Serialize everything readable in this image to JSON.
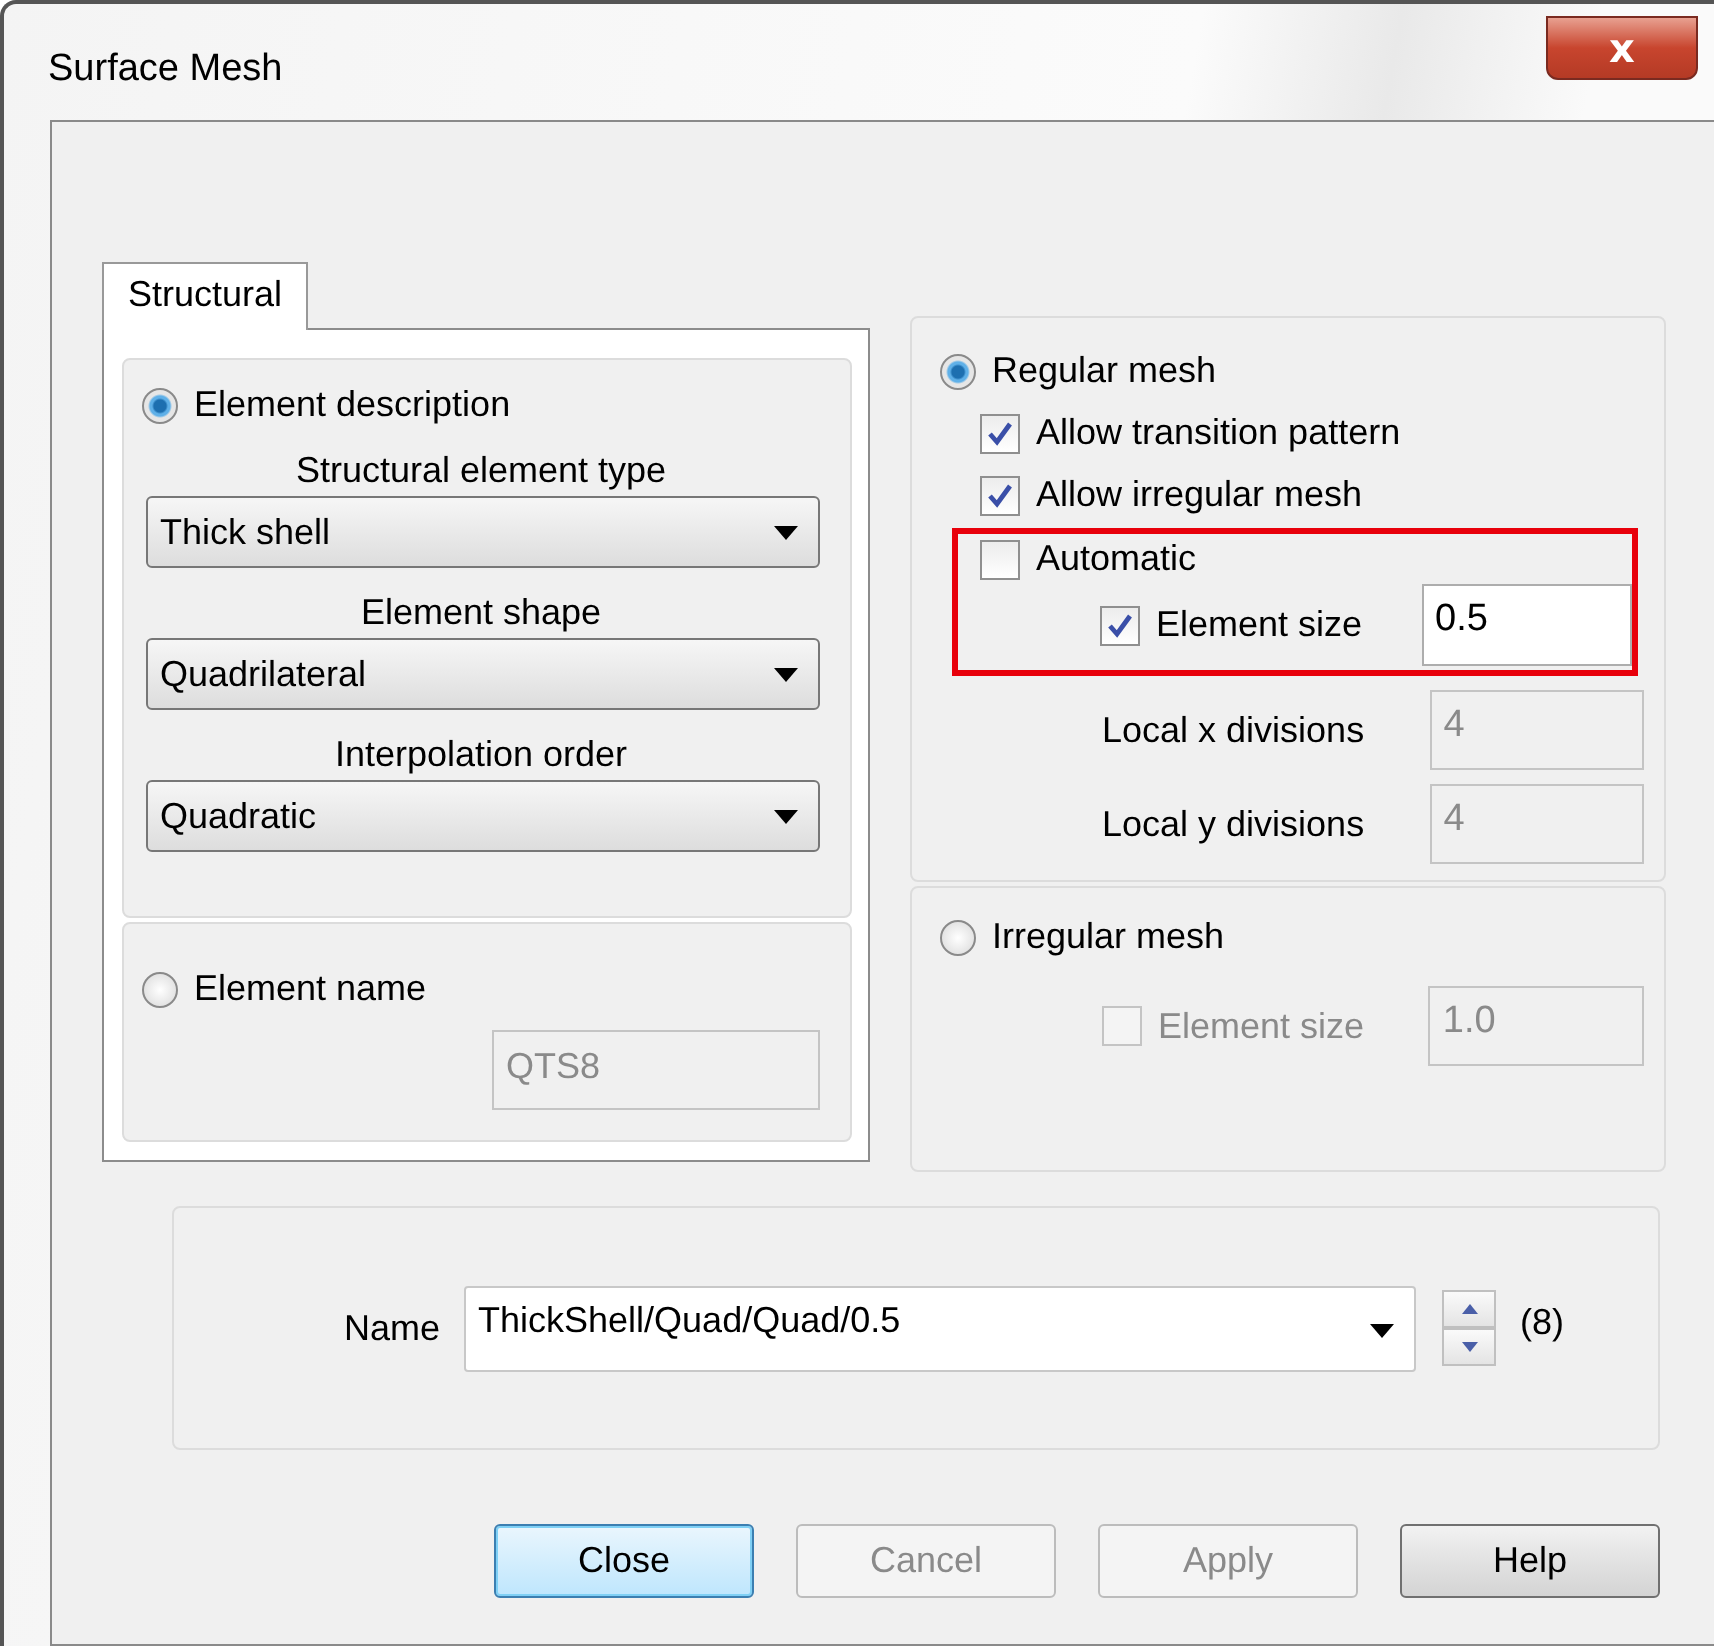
{
  "window": {
    "title": "Surface Mesh",
    "close_glyph": "x"
  },
  "tabs": [
    {
      "label": "Structural",
      "selected": true
    }
  ],
  "element_description": {
    "label": "Element description",
    "selected": true,
    "fields": [
      {
        "label": "Structural element type",
        "value": "Thick shell"
      },
      {
        "label": "Element shape",
        "value": "Quadrilateral"
      },
      {
        "label": "Interpolation order",
        "value": "Quadratic"
      }
    ]
  },
  "element_name": {
    "label": "Element name",
    "selected": false,
    "value": "QTS8",
    "disabled": true
  },
  "regular_mesh": {
    "label": "Regular mesh",
    "selected": true,
    "options": [
      {
        "label": "Allow transition pattern",
        "checked": true
      },
      {
        "label": "Allow irregular mesh",
        "checked": true
      }
    ],
    "automatic": {
      "label": "Automatic",
      "checked": false
    },
    "element_size": {
      "label": "Element size",
      "checked": true,
      "value": "0.5",
      "disabled": false
    },
    "divisions": [
      {
        "label": "Local x divisions",
        "value": "4",
        "disabled": true
      },
      {
        "label": "Local y divisions",
        "value": "4",
        "disabled": true
      }
    ]
  },
  "irregular_mesh": {
    "label": "Irregular mesh",
    "selected": false,
    "element_size": {
      "label": "Element size",
      "checked": false,
      "value": "1.0",
      "disabled": true
    }
  },
  "name": {
    "label": "Name",
    "value": "ThickShell/Quad/Quad/0.5",
    "count": "(8)"
  },
  "buttons": [
    {
      "label": "Close",
      "disabled": false,
      "default": true
    },
    {
      "label": "Cancel",
      "disabled": true,
      "default": false
    },
    {
      "label": "Apply",
      "disabled": true,
      "default": false
    },
    {
      "label": "Help",
      "disabled": false,
      "default": false
    }
  ]
}
